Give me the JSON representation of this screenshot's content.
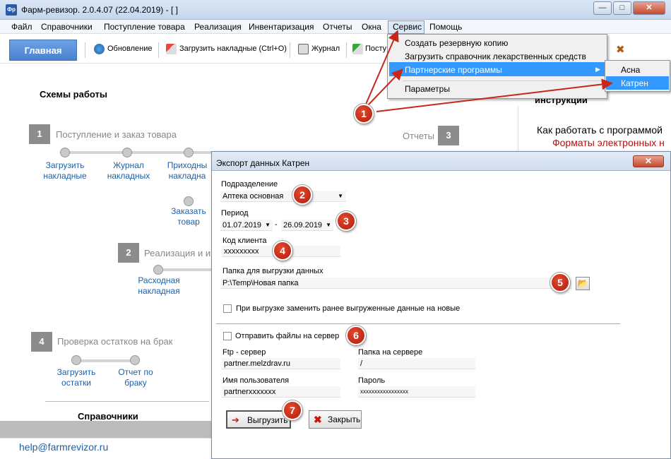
{
  "window": {
    "icon_text": "Фр",
    "title": "Фарм-ревизор. 2.0.4.07 (22.04.2019) - [ ]",
    "minimize": "—",
    "maximize": "□",
    "close": "✕"
  },
  "menu": {
    "items": [
      "Файл",
      "Справочники",
      "Поступление товара",
      "Реализация",
      "Инвентаризация",
      "Отчеты",
      "Окна",
      "Сервис",
      "Помощь"
    ]
  },
  "toolbar": {
    "main_tab": "Главная",
    "items": [
      "Обновление",
      "Загрузить накладные (Ctrl+O)",
      "Журнал",
      "Посту"
    ]
  },
  "service_menu": {
    "items": [
      "Создать резервную копию",
      "Загрузить справочник лекарственных средств",
      "Партнерские программы",
      "Параметры"
    ],
    "submenu_arrow": "▶",
    "submenu": [
      "Асна",
      "Катрен"
    ]
  },
  "background": {
    "schemes_title": "Схемы работы",
    "steps": [
      {
        "num": "1",
        "title": "Поступление и заказ товара"
      },
      {
        "num": "2",
        "title": "Реализация и и"
      },
      {
        "num": "3",
        "title": "Отчеты"
      },
      {
        "num": "4",
        "title": "Проверка остатков на брак"
      }
    ],
    "links_step1": [
      "Загрузить накладные",
      "Журнал накладных",
      "Приходны накладна",
      "Заказать товар",
      "Отчет по брак"
    ],
    "links_step2": [
      "Расходная накладная"
    ],
    "links_step4": [
      "Загрузить остатки",
      "Отчет по браку"
    ],
    "reference_title": "Справочники",
    "instructions": "инструкции",
    "how_to": "Как работать с программой",
    "formats": "Форматы электронных н",
    "email": "help@farmrevizor.ru"
  },
  "dialog": {
    "title": "Экспорт данных Катрен",
    "close": "✕",
    "division_label": "Подразделение",
    "division_value": "Аптека основная",
    "period_label": "Период",
    "date_from": "01.07.2019",
    "date_sep": "-",
    "date_to": "26.09.2019",
    "client_code_label": "Код клиента",
    "client_code_value": "xxxxxxxxx",
    "folder_label": "Папка для выгрузки данных",
    "folder_value": "P:\\Temp\\Новая папка",
    "replace_label": "При выгрузке заменить ранее выгруженные данные на новые",
    "send_label": "Отправить файлы на сервер",
    "ftp_label": "Ftp - сервер",
    "ftp_value": "partner.melzdrav.ru",
    "server_folder_label": "Папка на сервере",
    "server_folder_value": "/",
    "username_label": "Имя пользователя",
    "username_value": "partnerxxxxxxx",
    "password_label": "Пароль",
    "password_value": "xxxxxxxxxxxxxxxxx",
    "export_button": "Выгрузить",
    "close_button": "Закрыть"
  },
  "annotations": [
    "1",
    "2",
    "3",
    "4",
    "5",
    "6",
    "7"
  ],
  "colors": {
    "highlight": "#3399ff",
    "badge": "#c8261a",
    "arrow": "#c8261a",
    "link": "#1c5fa8"
  }
}
